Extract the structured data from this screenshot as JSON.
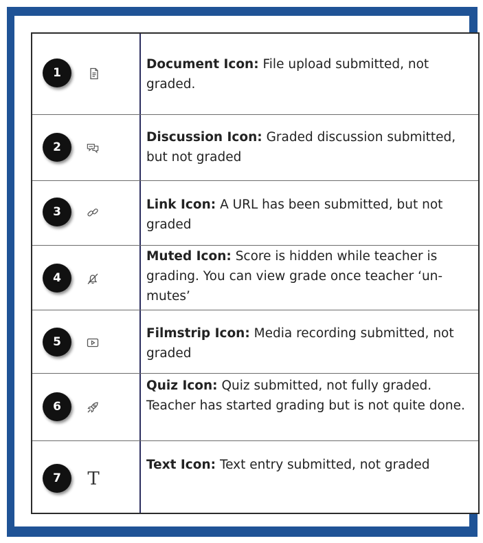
{
  "legend": {
    "rows": [
      {
        "number": "1",
        "icon": "document-icon",
        "term": "Document Icon:",
        "description": "File upload submitted, not graded."
      },
      {
        "number": "2",
        "icon": "discussion-icon",
        "term": "Discussion Icon:",
        "description": "Graded discussion submitted, but not graded"
      },
      {
        "number": "3",
        "icon": "link-icon",
        "term": "Link Icon:",
        "description": "A URL has been submitted, but not graded"
      },
      {
        "number": "4",
        "icon": "muted-icon",
        "term": "Muted Icon:",
        "description": "Score is hidden while teacher is grading. You can view grade once teacher ‘un-mutes’"
      },
      {
        "number": "5",
        "icon": "filmstrip-icon",
        "term": "Filmstrip Icon:",
        "description": "Media recording submitted, not graded"
      },
      {
        "number": "6",
        "icon": "quiz-icon",
        "term": "Quiz Icon:",
        "description": "Quiz submitted, not fully graded. Teacher has started grading but is not quite done."
      },
      {
        "number": "7",
        "icon": "text-icon",
        "term": "Text Icon:",
        "description": "Text entry submitted, not graded",
        "glyph": "T"
      }
    ]
  },
  "colors": {
    "border_blue": "#1f5396",
    "badge": "#111111",
    "divider": "#2a2d5e"
  }
}
